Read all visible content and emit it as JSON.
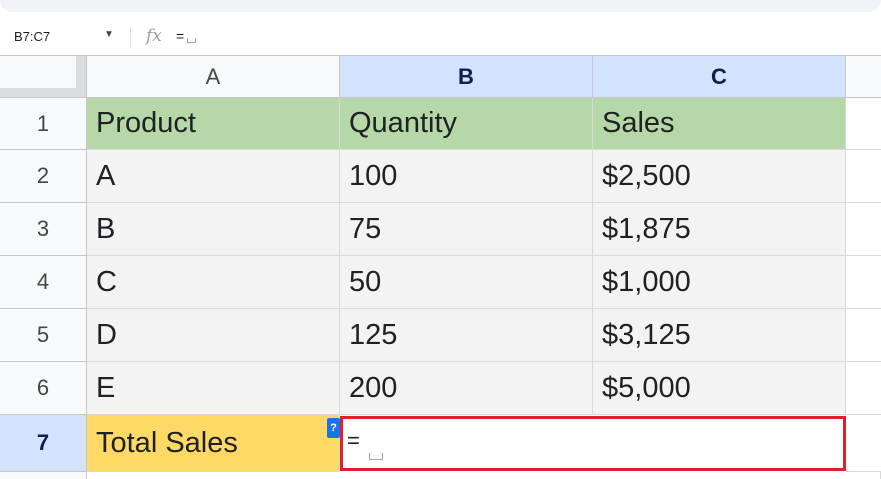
{
  "formula_bar": {
    "name_box": "B7:C7",
    "dropdown": "▼",
    "fx": "fx",
    "value": "="
  },
  "columns": [
    {
      "label": "A",
      "selected": false
    },
    {
      "label": "B",
      "selected": true
    },
    {
      "label": "C",
      "selected": true
    }
  ],
  "rows": [
    {
      "num": "1",
      "cells": [
        "Product",
        "Quantity",
        "Sales"
      ]
    },
    {
      "num": "2",
      "cells": [
        "A",
        "100",
        "$2,500"
      ]
    },
    {
      "num": "3",
      "cells": [
        "B",
        "75",
        "$1,875"
      ]
    },
    {
      "num": "4",
      "cells": [
        "C",
        "50",
        "$1,000"
      ]
    },
    {
      "num": "5",
      "cells": [
        "D",
        "125",
        "$3,125"
      ]
    },
    {
      "num": "6",
      "cells": [
        "E",
        "200",
        "$5,000"
      ]
    },
    {
      "num": "7",
      "cells": [
        "Total Sales",
        "=",
        ""
      ]
    }
  ],
  "editor": {
    "text": "=",
    "help_badge": "?"
  },
  "colors": {
    "header_fill": "#b6d7a8",
    "total_fill": "#ffd966",
    "selection_header": "#d3e3fd",
    "edit_border": "#e31e2f"
  }
}
